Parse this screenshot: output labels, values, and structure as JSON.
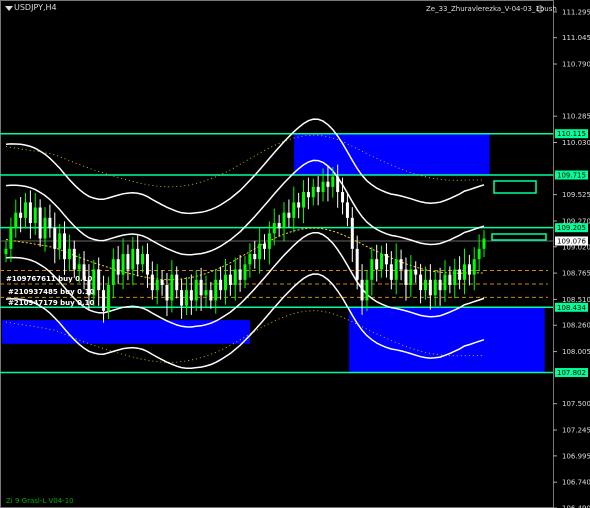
{
  "window": {
    "symbol_label": "USDJPY,H4",
    "expert_label": "Ze_33_Zhuravlerezka_V-04-03_1bush",
    "indicator_label": "Zi 9 Grasl-L V04-10"
  },
  "colors": {
    "background": "#000000",
    "bull_candle": "#00ff00",
    "bear_candle": "#ffffff",
    "zone_fill": "#0000ff",
    "level_line": "#00ff99",
    "envelope": "#ffffff",
    "ma_dots": "#ffd700",
    "order_line": "#cc8800"
  },
  "orders": [
    {
      "label": "#109767611 buy 0.10"
    },
    {
      "label": "#210937485 buy 0.10"
    },
    {
      "label": "#210947179 buy 0.10"
    }
  ],
  "price_axis": {
    "ticks": [
      "111.295",
      "111.045",
      "110.790",
      "110.285",
      "110.030",
      "109.525",
      "109.270",
      "109.020",
      "108.765",
      "108.510",
      "108.260",
      "108.005",
      "107.500",
      "107.245",
      "106.995",
      "106.740",
      "106.490"
    ]
  },
  "price_tags": [
    {
      "label": "110.115",
      "color": "#00ff99"
    },
    {
      "label": "109.715",
      "color": "#00ff99"
    },
    {
      "label": "109.205",
      "color": "#00ff99"
    },
    {
      "label": "109.076",
      "color": "#ffffff"
    },
    {
      "label": "108.434",
      "color": "#00ff99"
    },
    {
      "label": "107.802",
      "color": "#00ff99"
    }
  ],
  "chart_data": {
    "type": "candlestick",
    "title": "USDJPY,H4",
    "ylim": [
      106.49,
      111.41
    ],
    "current_price": 109.076,
    "horizontal_levels": [
      110.115,
      109.715,
      109.205,
      108.434,
      107.802
    ],
    "zones": [
      {
        "x_start": 0.53,
        "x_end": 0.885,
        "top": 110.115,
        "bottom": 109.715
      },
      {
        "x_start": 0.0,
        "x_end": 0.45,
        "top": 108.31,
        "bottom": 108.08
      },
      {
        "x_start": 0.63,
        "x_end": 0.985,
        "top": 108.434,
        "bottom": 107.802
      }
    ],
    "order_levels": [
      108.79,
      108.66,
      108.53
    ],
    "close_series": [
      109.0,
      109.2,
      109.35,
      109.3,
      109.45,
      109.25,
      109.4,
      109.1,
      109.3,
      109.2,
      109.0,
      109.15,
      108.9,
      109.0,
      108.8,
      108.85,
      108.7,
      108.55,
      108.8,
      108.6,
      108.4,
      108.65,
      108.9,
      108.75,
      108.95,
      108.8,
      109.0,
      108.85,
      108.95,
      108.75,
      108.6,
      108.7,
      108.65,
      108.5,
      108.75,
      108.6,
      108.45,
      108.6,
      108.5,
      108.7,
      108.55,
      108.6,
      108.5,
      108.7,
      108.6,
      108.75,
      108.65,
      108.8,
      108.7,
      108.85,
      108.95,
      108.9,
      109.05,
      109.0,
      109.15,
      109.25,
      109.2,
      109.35,
      109.3,
      109.45,
      109.4,
      109.55,
      109.5,
      109.6,
      109.55,
      109.65,
      109.6,
      109.7,
      109.55,
      109.45,
      109.3,
      109.0,
      108.7,
      108.5,
      108.7,
      108.9,
      108.8,
      108.95,
      108.85,
      108.7,
      108.9,
      108.8,
      108.65,
      108.8,
      108.75,
      108.6,
      108.7,
      108.55,
      108.7,
      108.6,
      108.75,
      108.65,
      108.8,
      108.7,
      108.85,
      108.75,
      108.9,
      109.0,
      109.1
    ]
  }
}
